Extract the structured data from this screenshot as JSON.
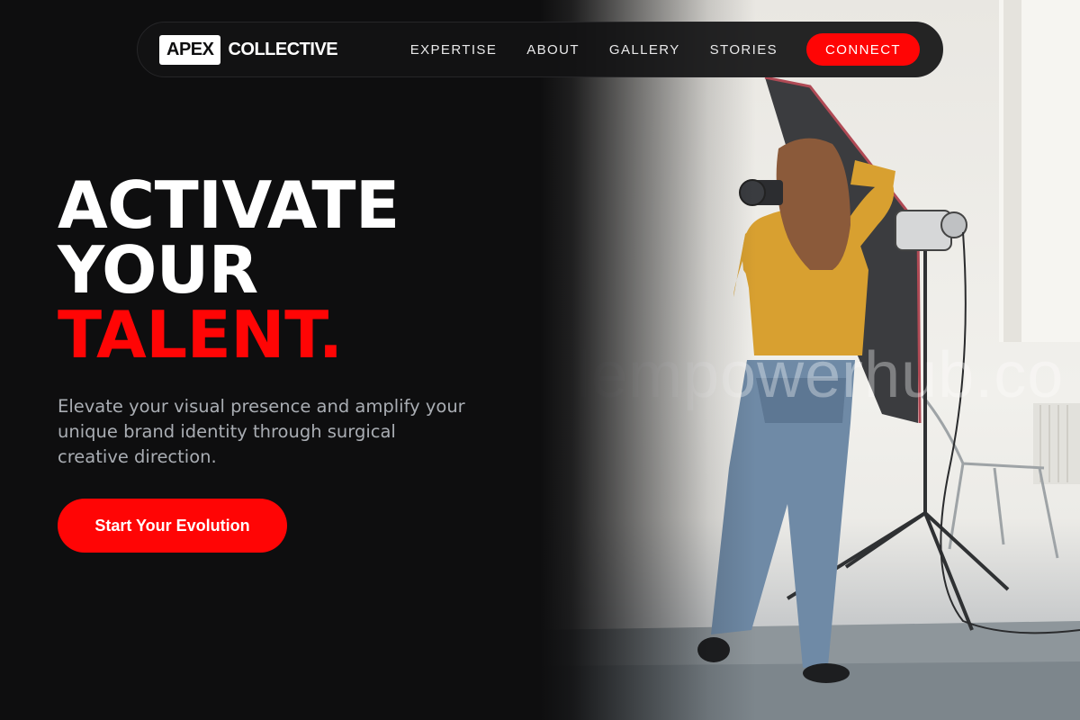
{
  "brand": {
    "logo_box": "APEX",
    "logo_text": "COLLECTIVE"
  },
  "nav": {
    "links": [
      "EXPERTISE",
      "ABOUT",
      "GALLERY",
      "STORIES"
    ],
    "connect_label": "CONNECT"
  },
  "hero": {
    "line1": "ACTIVATE",
    "line2": "YOUR",
    "line3": "TALENT.",
    "description": "Elevate your visual presence and amplify your unique brand identity through surgical creative direction.",
    "cta_label": "Start Your Evolution"
  },
  "photo": {
    "watermark": "lempowerhub.co"
  },
  "colors": {
    "accent": "#ff0505",
    "background": "#0e0e0f",
    "text": "#ffffff",
    "muted": "#a9adb3"
  }
}
